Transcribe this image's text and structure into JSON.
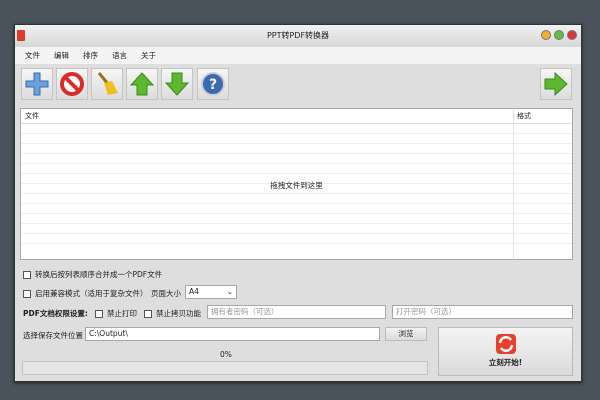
{
  "window": {
    "title": "PPT转PDF转换器"
  },
  "menu": [
    "文件",
    "编辑",
    "排序",
    "语言",
    "关于"
  ],
  "toolbar": [
    {
      "icon": "add-icon"
    },
    {
      "icon": "remove-icon"
    },
    {
      "icon": "clear-icon"
    },
    {
      "icon": "move-up-icon"
    },
    {
      "icon": "move-down-icon"
    },
    {
      "icon": "help-icon"
    },
    {
      "icon": "next-icon"
    }
  ],
  "list": {
    "col_file": "文件",
    "col_format": "格式",
    "placeholder": "拖拽文件到这里"
  },
  "options": {
    "merge": "转换后按列表顺序合并成一个PDF文件",
    "compat": "启用兼容模式（适用于复杂文件）",
    "page_size_label": "页面大小",
    "page_size": "A4",
    "perm_label": "PDF文档权限设置:",
    "no_print": "禁止打印",
    "no_copy": "禁止拷贝功能",
    "owner_pw_placeholder": "拥有者密码（可选）",
    "open_pw_placeholder": "打开密码（可选）"
  },
  "output": {
    "label": "选择保存文件位置",
    "path": "C:\\Output\\",
    "browse": "浏览",
    "progress_text": "0%",
    "progress": 0
  },
  "start": {
    "label": "立刻开始!"
  },
  "colors": {
    "accent_green": "#5cb82e",
    "red": "#e8402c"
  }
}
